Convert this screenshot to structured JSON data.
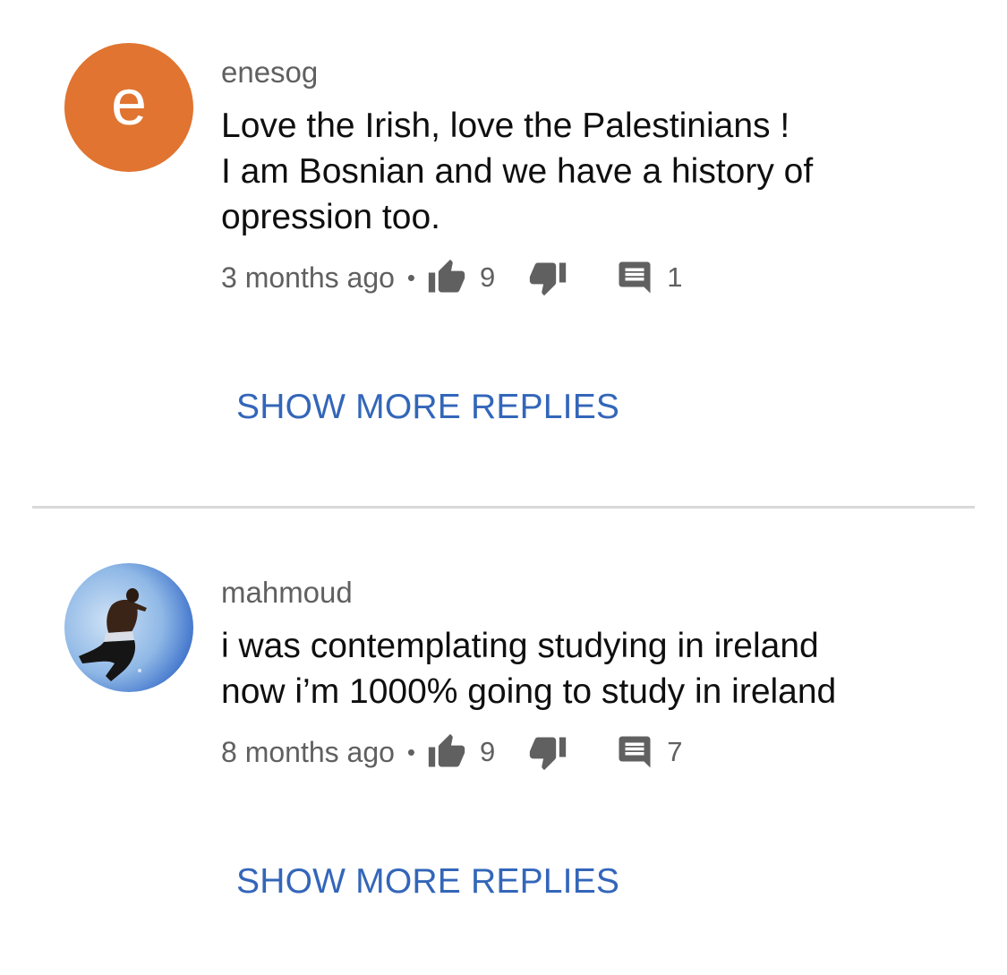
{
  "comments": [
    {
      "author": "enesog",
      "avatar": {
        "type": "letter",
        "letter": "e",
        "color": "#e07430"
      },
      "text_lines": [
        "Love the Irish, love the Palestinians !",
        "I am Bosnian and we have a history of",
        "opression too."
      ],
      "time": "3 months ago",
      "separator": "•",
      "likes": "9",
      "replies": "1",
      "more_replies_label": "SHOW MORE REPLIES"
    },
    {
      "author": "mahmoud",
      "avatar": {
        "type": "photo",
        "description_icon": "person-photo"
      },
      "text_lines": [
        "i was contemplating studying in ireland",
        "now i’m 1000% going to study in ireland"
      ],
      "time": "8 months ago",
      "separator": "•",
      "likes": "9",
      "replies": "7",
      "more_replies_label": "SHOW MORE REPLIES"
    }
  ],
  "colors": {
    "link": "#3366b9",
    "icon": "#606060",
    "divider": "#d9d9d9"
  },
  "icons": {
    "like": "thumbs-up-icon",
    "dislike": "thumbs-down-icon",
    "reply": "comment-icon"
  }
}
